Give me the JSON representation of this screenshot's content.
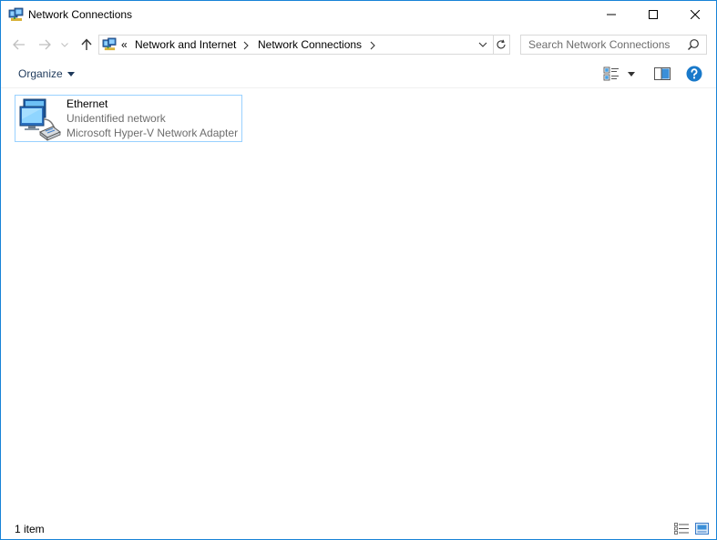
{
  "window": {
    "title": "Network Connections",
    "accent_color": "#1883d7"
  },
  "titlebar": {
    "icon": "network-connections-icon",
    "minimize_icon": "minimize-icon",
    "maximize_icon": "maximize-icon",
    "close_icon": "close-icon"
  },
  "navigation": {
    "back_icon": "back-arrow-icon",
    "forward_icon": "forward-arrow-icon",
    "recent_icon": "chevron-down-icon",
    "up_icon": "up-arrow-icon"
  },
  "address": {
    "overflow": "«",
    "breadcrumbs": [
      "Network and Internet",
      "Network Connections"
    ],
    "refresh_icon": "refresh-icon"
  },
  "search": {
    "placeholder": "Search Network Connections",
    "value": ""
  },
  "toolbar": {
    "organize_label": "Organize",
    "view_options_icon": "change-view-icon",
    "preview_pane_icon": "preview-pane-icon",
    "help_icon": "help-icon",
    "help_color": "#1979ca"
  },
  "items": [
    {
      "name": "Ethernet",
      "status": "Unidentified network",
      "device": "Microsoft Hyper-V Network Adapter",
      "icon": "ethernet-adapter-icon",
      "selection_border": "#99d1ff"
    }
  ],
  "statusbar": {
    "count": "1 item",
    "details_view_icon": "details-view-icon",
    "large_icons_view_icon": "large-icons-view-icon"
  }
}
